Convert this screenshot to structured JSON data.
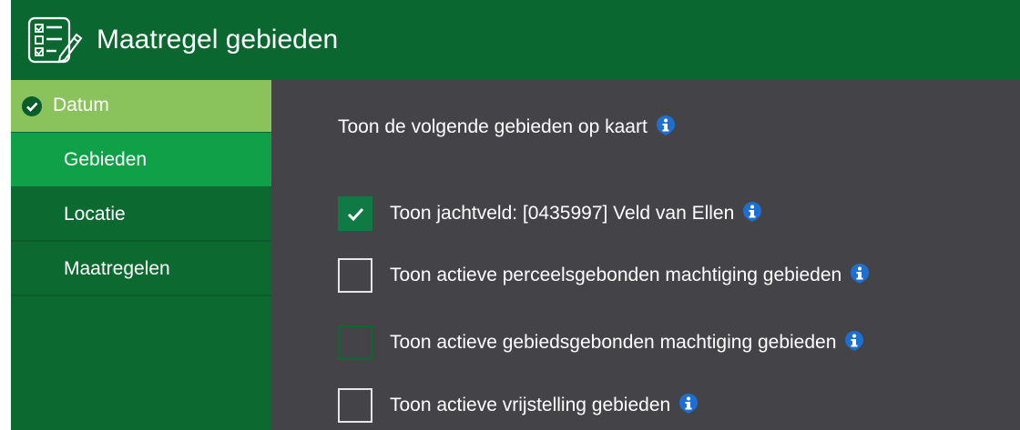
{
  "header": {
    "title": "Maatregel gebieden",
    "icon": "checklist-edit-icon"
  },
  "sidebar": {
    "items": [
      {
        "label": "Datum",
        "state": "done"
      },
      {
        "label": "Gebieden",
        "state": "active"
      },
      {
        "label": "Locatie",
        "state": "default"
      },
      {
        "label": "Maatregelen",
        "state": "default"
      }
    ]
  },
  "main": {
    "intro": "Toon de volgende gebieden op kaart",
    "options": [
      {
        "label": "Toon jachtveld: [0435997] Veld van Ellen",
        "checked": true
      },
      {
        "label": "Toon actieve perceelsgebonden machtiging gebieden",
        "checked": false
      },
      {
        "label": "Toon actieve gebiedsgebonden machtiging gebieden",
        "checked": false
      },
      {
        "label": "Toon actieve vrijstelling gebieden",
        "checked": false
      }
    ]
  },
  "colors": {
    "header_bg": "#0a6730",
    "sidebar_bg": "#0c6a31",
    "done_bg": "#8ac35b",
    "active_bg": "#10a048",
    "main_bg": "#444448",
    "checkbox_checked": "#0f7a43",
    "info_icon": "#1e6fd2"
  }
}
